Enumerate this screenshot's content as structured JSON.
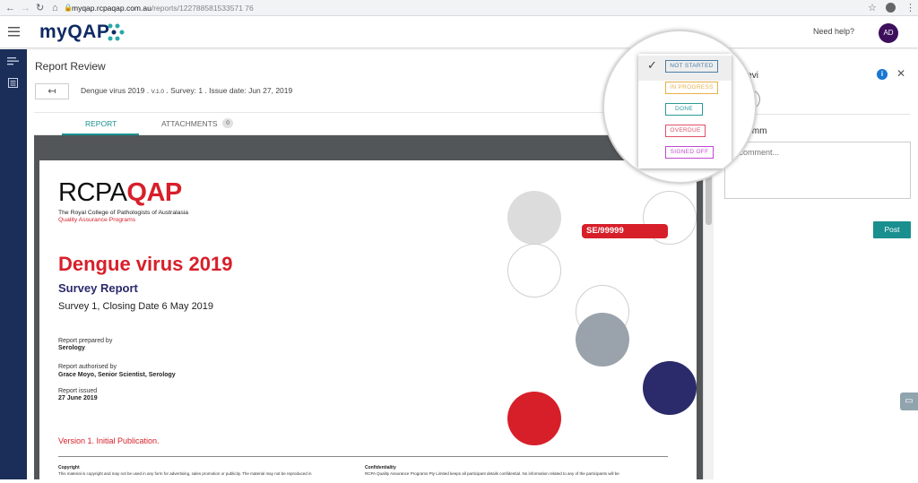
{
  "browser": {
    "url_host": "myqap.rcpaqap.com.au",
    "url_path": "/reports/122788581533571 76"
  },
  "app": {
    "logo": "myQAP",
    "need_help": "Need help?",
    "avatar_initials": "AD"
  },
  "page": {
    "title": "Report Review",
    "doc_title": "Dengue virus 2019",
    "doc_version": "V.1.0",
    "doc_rest": ". Survey: 1 . Issue date: Jun 27, 2019"
  },
  "tabs": [
    {
      "label": "REPORT"
    },
    {
      "label": "ATTACHMENTS",
      "badge": "0"
    }
  ],
  "report": {
    "logo_main": "RCPA",
    "logo_accent": "QAP",
    "org_line1": "The Royal College of Pathologists of Australasia",
    "org_line2": "Quality Assurance Programs",
    "tag": "SE/99999",
    "title": "Dengue virus 2019",
    "subtitle": "Survey Report",
    "survey_line": "Survey 1, Closing Date 6 May 2019",
    "prepared_label": "Report prepared by",
    "prepared_value": "Serology",
    "authorised_label": "Report authorised by",
    "authorised_value": "Grace Moyo, Senior Scientist, Serology",
    "issued_label": "Report issued",
    "issued_value": "27 June 2019",
    "version_line": "Version 1. Initial Publication.",
    "copyright_heading": "Copyright",
    "copyright_text": "This material is copyright and may not be used in any form for advertising, sales promotion or publicity. The material may not be reproduced in",
    "confidentiality_heading": "Confidentiality",
    "confidentiality_text": "RCPA Quality Assurance Programs Pty Limited keeps all participant details confidential. No information related to any of the participants will be",
    "colors": {
      "red": "#d71f2a",
      "navy": "#2b2a6b"
    }
  },
  "status_menu": {
    "items": [
      {
        "label": "NOT STARTED",
        "color": "#4a7fa8",
        "selected": true
      },
      {
        "label": "IN PROGRESS",
        "color": "#e6b04a"
      },
      {
        "label": "DONE",
        "color": "#2a9a9a"
      },
      {
        "label": "OVERDUE",
        "color": "#e0506a"
      },
      {
        "label": "SIGNED OFF",
        "color": "#c04ad0"
      }
    ]
  },
  "review_panel": {
    "reviewers_label": "Revi",
    "comments_label": "Comm",
    "comment_placeholder": "a comment...",
    "post_label": "Post"
  },
  "icons": {
    "menu": "hamburger-icon",
    "info": "info-icon",
    "close": "close-icon",
    "add_reviewer": "add-user-icon",
    "chat": "chat-icon"
  }
}
